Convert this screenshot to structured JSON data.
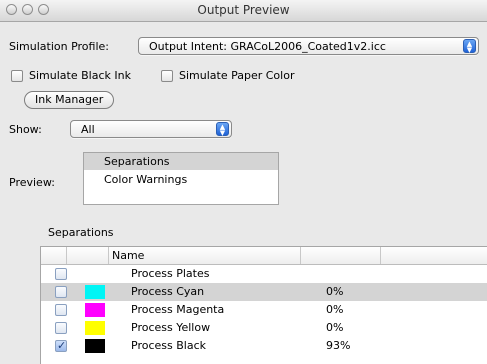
{
  "window": {
    "title": "Output Preview"
  },
  "simulation_profile": {
    "label": "Simulation Profile:",
    "value": "Output Intent: GRACoL2006_Coated1v2.icc"
  },
  "options": {
    "simulate_black_ink": "Simulate Black Ink",
    "simulate_paper_color": "Simulate Paper Color"
  },
  "ink_manager": {
    "label": "Ink Manager"
  },
  "show": {
    "label": "Show:",
    "value": "All"
  },
  "preview": {
    "label": "Preview:",
    "items": [
      "Separations",
      "Color Warnings"
    ]
  },
  "separations": {
    "group_label": "Separations",
    "columns": [
      "Name"
    ],
    "rows": [
      {
        "name": "Process Plates",
        "percent": "",
        "swatch": null,
        "checked": false,
        "selected": false
      },
      {
        "name": "Process Cyan",
        "percent": "0%",
        "swatch": "#00f5f5",
        "checked": false,
        "selected": true
      },
      {
        "name": "Process Magenta",
        "percent": "0%",
        "swatch": "#ff00ff",
        "checked": false,
        "selected": false
      },
      {
        "name": "Process Yellow",
        "percent": "0%",
        "swatch": "#ffff00",
        "checked": false,
        "selected": false
      },
      {
        "name": "Process Black",
        "percent": "93%",
        "swatch": "#000000",
        "checked": true,
        "selected": false
      }
    ]
  },
  "icons": {
    "check": "checkmark-icon",
    "popup_arrow": "updown-arrow-icon"
  }
}
